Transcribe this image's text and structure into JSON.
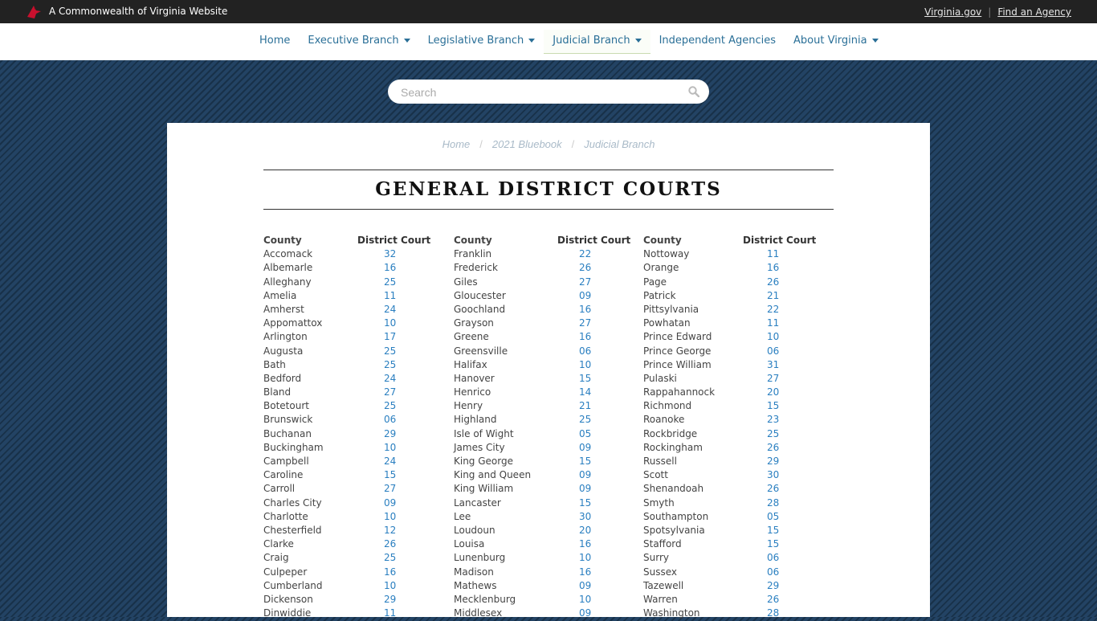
{
  "topbar": {
    "site_label": "A Commonwealth of Virginia Website",
    "links": [
      "Virginia.gov",
      "Find an Agency"
    ]
  },
  "nav": {
    "items": [
      "Home",
      "Executive Branch",
      "Legislative Branch",
      "Judicial Branch",
      "Independent Agencies",
      "About Virginia"
    ]
  },
  "search": {
    "placeholder": "Search"
  },
  "breadcrumb": [
    "Home",
    "2021 Bluebook",
    "Judicial Branch"
  ],
  "page": {
    "title": "GENERAL DISTRICT COURTS"
  },
  "table": {
    "headers": {
      "county": "County",
      "court": "District Court"
    },
    "columns": [
      [
        [
          "Accomack",
          "32"
        ],
        [
          "Albemarle",
          "16"
        ],
        [
          "Alleghany",
          "25"
        ],
        [
          "Amelia",
          "11"
        ],
        [
          "Amherst",
          "24"
        ],
        [
          "Appomattox",
          "10"
        ],
        [
          "Arlington",
          "17"
        ],
        [
          "Augusta",
          "25"
        ],
        [
          "Bath",
          "25"
        ],
        [
          "Bedford",
          "24"
        ],
        [
          "Bland",
          "27"
        ],
        [
          "Botetourt",
          "25"
        ],
        [
          "Brunswick",
          "06"
        ],
        [
          "Buchanan",
          "29"
        ],
        [
          "Buckingham",
          "10"
        ],
        [
          "Campbell",
          "24"
        ],
        [
          "Caroline",
          "15"
        ],
        [
          "Carroll",
          "27"
        ],
        [
          "Charles City",
          "09"
        ],
        [
          "Charlotte",
          "10"
        ],
        [
          "Chesterfield",
          "12"
        ],
        [
          "Clarke",
          "26"
        ],
        [
          "Craig",
          "25"
        ],
        [
          "Culpeper",
          "16"
        ],
        [
          "Cumberland",
          "10"
        ],
        [
          "Dickenson",
          "29"
        ],
        [
          "Dinwiddie",
          "11"
        ]
      ],
      [
        [
          "Franklin",
          "22"
        ],
        [
          "Frederick",
          "26"
        ],
        [
          "Giles",
          "27"
        ],
        [
          "Gloucester",
          "09"
        ],
        [
          "Goochland",
          "16"
        ],
        [
          "Grayson",
          "27"
        ],
        [
          "Greene",
          "16"
        ],
        [
          "Greensville",
          "06"
        ],
        [
          "Halifax",
          "10"
        ],
        [
          "Hanover",
          "15"
        ],
        [
          "Henrico",
          "14"
        ],
        [
          "Henry",
          "21"
        ],
        [
          "Highland",
          "25"
        ],
        [
          "Isle of Wight",
          "05"
        ],
        [
          "James City",
          "09"
        ],
        [
          "King George",
          "15"
        ],
        [
          "King and Queen",
          "09"
        ],
        [
          "King William",
          "09"
        ],
        [
          "Lancaster",
          "15"
        ],
        [
          "Lee",
          "30"
        ],
        [
          "Loudoun",
          "20"
        ],
        [
          "Louisa",
          "16"
        ],
        [
          "Lunenburg",
          "10"
        ],
        [
          "Madison",
          "16"
        ],
        [
          "Mathews",
          "09"
        ],
        [
          "Mecklenburg",
          "10"
        ],
        [
          "Middlesex",
          "09"
        ]
      ],
      [
        [
          "Nottoway",
          "11"
        ],
        [
          "Orange",
          "16"
        ],
        [
          "Page",
          "26"
        ],
        [
          "Patrick",
          "21"
        ],
        [
          "Pittsylvania",
          "22"
        ],
        [
          "Powhatan",
          "11"
        ],
        [
          "Prince Edward",
          "10"
        ],
        [
          "Prince George",
          "06"
        ],
        [
          "Prince William",
          "31"
        ],
        [
          "Pulaski",
          "27"
        ],
        [
          "Rappahannock",
          "20"
        ],
        [
          "Richmond",
          "15"
        ],
        [
          "Roanoke",
          "23"
        ],
        [
          "Rockbridge",
          "25"
        ],
        [
          "Rockingham",
          "26"
        ],
        [
          "Russell",
          "29"
        ],
        [
          "Scott",
          "30"
        ],
        [
          "Shenandoah",
          "26"
        ],
        [
          "Smyth",
          "28"
        ],
        [
          "Southampton",
          "05"
        ],
        [
          "Spotsylvania",
          "15"
        ],
        [
          "Stafford",
          "15"
        ],
        [
          "Surry",
          "06"
        ],
        [
          "Sussex",
          "06"
        ],
        [
          "Tazewell",
          "29"
        ],
        [
          "Warren",
          "26"
        ],
        [
          "Washington",
          "28"
        ]
      ]
    ]
  }
}
